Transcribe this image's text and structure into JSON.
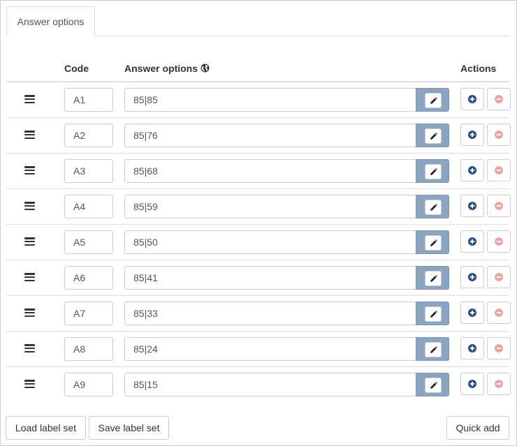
{
  "tabs": [
    {
      "label": "Answer options",
      "active": true
    }
  ],
  "table": {
    "headers": {
      "code": "Code",
      "answer_options": "Answer options",
      "actions": "Actions"
    },
    "rows": [
      {
        "code": "A1",
        "answer": "85|85"
      },
      {
        "code": "A2",
        "answer": "85|76"
      },
      {
        "code": "A3",
        "answer": "85|68"
      },
      {
        "code": "A4",
        "answer": "85|59"
      },
      {
        "code": "A5",
        "answer": "85|50"
      },
      {
        "code": "A6",
        "answer": "85|41"
      },
      {
        "code": "A7",
        "answer": "85|33"
      },
      {
        "code": "A8",
        "answer": "85|24"
      },
      {
        "code": "A9",
        "answer": "85|15"
      }
    ]
  },
  "footer": {
    "load_label_set": "Load label set",
    "save_label_set": "Save label set",
    "quick_add": "Quick add"
  },
  "icons": {
    "drag": "bars-icon",
    "globe": "globe-icon",
    "edit": "pencil-icon",
    "add": "plus-circle-icon",
    "remove": "minus-circle-icon"
  },
  "colors": {
    "addon_bg": "#8ba4bf",
    "add_icon": "#2c4f7c",
    "remove_icon": "#e8a5a5"
  }
}
